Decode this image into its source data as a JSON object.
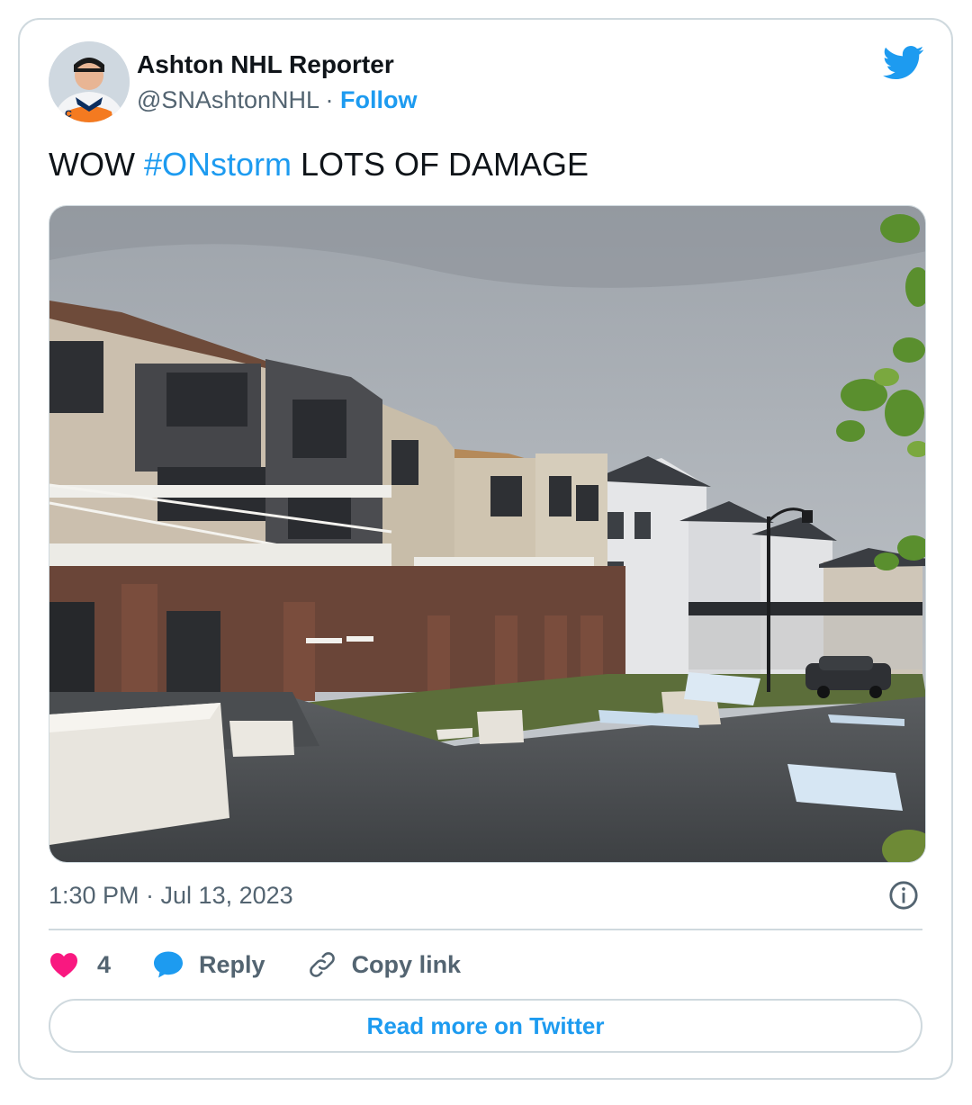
{
  "author": {
    "name": "Ashton NHL Reporter",
    "handle": "@SNAshtonNHL",
    "separator": "·",
    "follow_label": "Follow"
  },
  "tweet": {
    "text_before": "WOW ",
    "hashtag": "#ONstorm",
    "text_after": " LOTS OF DAMAGE",
    "timestamp": "1:30 PM · Jul 13, 2023"
  },
  "media": {
    "icon": "photo-storm-damaged-townhouses"
  },
  "actions": {
    "like_count": "4",
    "reply_label": "Reply",
    "copy_link_label": "Copy link"
  },
  "read_more_label": "Read more on Twitter",
  "colors": {
    "accent": "#1d9bf0",
    "heart": "#f91880",
    "text_primary": "#0f1419",
    "text_secondary": "#536471",
    "border": "#cfd9de"
  }
}
